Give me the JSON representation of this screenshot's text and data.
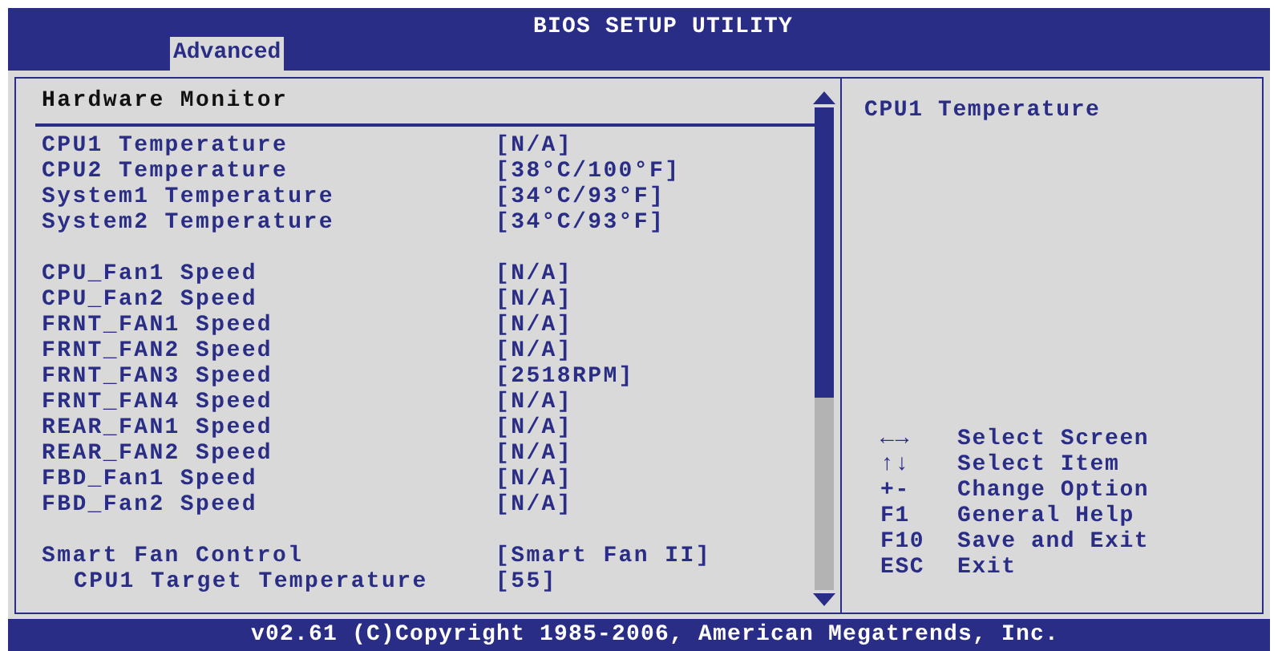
{
  "header": {
    "title": "BIOS SETUP UTILITY",
    "tabs": [
      {
        "label": "Advanced",
        "selected": true
      }
    ]
  },
  "section": {
    "title": "Hardware Monitor",
    "groups": [
      {
        "items": [
          {
            "label": "CPU1 Temperature",
            "value": "[N/A]"
          },
          {
            "label": "CPU2 Temperature",
            "value": "[38°C/100°F]"
          },
          {
            "label": "System1 Temperature",
            "value": "[34°C/93°F]"
          },
          {
            "label": "System2 Temperature",
            "value": "[34°C/93°F]"
          }
        ]
      },
      {
        "items": [
          {
            "label": "CPU_Fan1 Speed",
            "value": "[N/A]"
          },
          {
            "label": "CPU_Fan2 Speed",
            "value": "[N/A]"
          },
          {
            "label": "FRNT_FAN1 Speed",
            "value": "[N/A]"
          },
          {
            "label": "FRNT_FAN2 Speed",
            "value": "[N/A]"
          },
          {
            "label": "FRNT_FAN3 Speed",
            "value": "[2518RPM]"
          },
          {
            "label": "FRNT_FAN4 Speed",
            "value": "[N/A]"
          },
          {
            "label": "REAR_FAN1 Speed",
            "value": "[N/A]"
          },
          {
            "label": "REAR_FAN2 Speed",
            "value": "[N/A]"
          },
          {
            "label": "FBD_Fan1 Speed",
            "value": "[N/A]"
          },
          {
            "label": "FBD_Fan2 Speed",
            "value": "[N/A]"
          }
        ]
      },
      {
        "items": [
          {
            "label": "Smart Fan Control",
            "value": "[Smart Fan II]",
            "children": [
              {
                "label": "CPU1 Target Temperature",
                "value": "[55]"
              }
            ]
          }
        ]
      }
    ]
  },
  "help": {
    "text": "CPU1 Temperature",
    "keys": [
      {
        "key": "←→",
        "action": "Select Screen"
      },
      {
        "key": "↑↓",
        "action": "Select Item"
      },
      {
        "key": "+-",
        "action": "Change Option"
      },
      {
        "key": "F1",
        "action": "General Help"
      },
      {
        "key": "F10",
        "action": "Save and Exit"
      },
      {
        "key": "ESC",
        "action": "Exit"
      }
    ]
  },
  "footer": "v02.61 (C)Copyright 1985-2006, American Megatrends, Inc."
}
